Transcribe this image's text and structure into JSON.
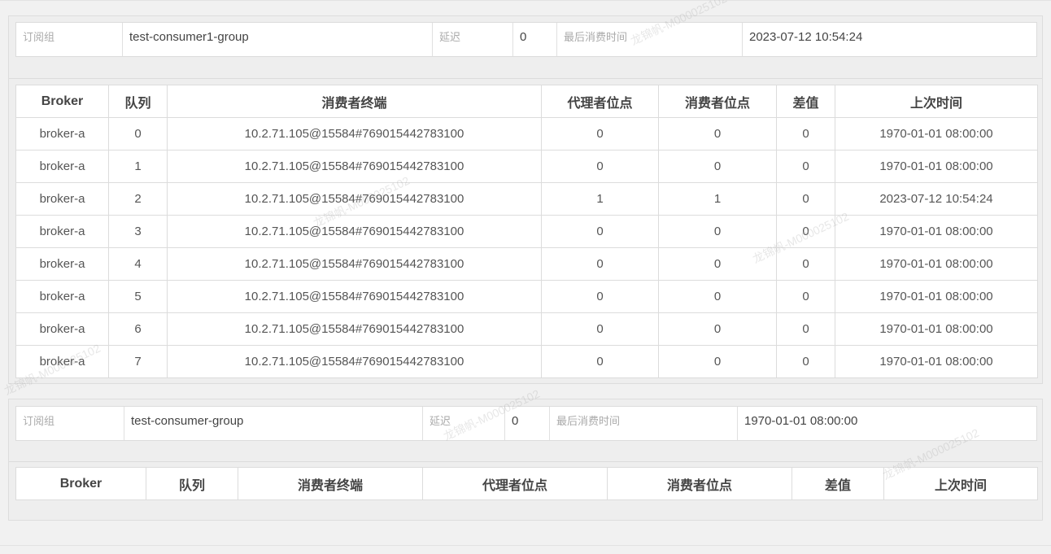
{
  "watermark": "龙锦帆-M000025102",
  "groups": [
    {
      "info": {
        "group_label": "订阅组",
        "group_value": "test-consumer1-group",
        "delay_label": "延迟",
        "delay_value": "0",
        "last_label": "最后消费时间",
        "last_value": "2023-07-12 10:54:24"
      },
      "headers": [
        "Broker",
        "队列",
        "消费者终端",
        "代理者位点",
        "消费者位点",
        "差值",
        "上次时间"
      ],
      "rows": [
        [
          "broker-a",
          "0",
          "10.2.71.105@15584#769015442783100",
          "0",
          "0",
          "0",
          "1970-01-01 08:00:00"
        ],
        [
          "broker-a",
          "1",
          "10.2.71.105@15584#769015442783100",
          "0",
          "0",
          "0",
          "1970-01-01 08:00:00"
        ],
        [
          "broker-a",
          "2",
          "10.2.71.105@15584#769015442783100",
          "1",
          "1",
          "0",
          "2023-07-12 10:54:24"
        ],
        [
          "broker-a",
          "3",
          "10.2.71.105@15584#769015442783100",
          "0",
          "0",
          "0",
          "1970-01-01 08:00:00"
        ],
        [
          "broker-a",
          "4",
          "10.2.71.105@15584#769015442783100",
          "0",
          "0",
          "0",
          "1970-01-01 08:00:00"
        ],
        [
          "broker-a",
          "5",
          "10.2.71.105@15584#769015442783100",
          "0",
          "0",
          "0",
          "1970-01-01 08:00:00"
        ],
        [
          "broker-a",
          "6",
          "10.2.71.105@15584#769015442783100",
          "0",
          "0",
          "0",
          "1970-01-01 08:00:00"
        ],
        [
          "broker-a",
          "7",
          "10.2.71.105@15584#769015442783100",
          "0",
          "0",
          "0",
          "1970-01-01 08:00:00"
        ]
      ]
    },
    {
      "info": {
        "group_label": "订阅组",
        "group_value": "test-consumer-group",
        "delay_label": "延迟",
        "delay_value": "0",
        "last_label": "最后消费时间",
        "last_value": "1970-01-01 08:00:00"
      },
      "headers": [
        "Broker",
        "队列",
        "消费者终端",
        "代理者位点",
        "消费者位点",
        "差值",
        "上次时间"
      ],
      "rows": []
    }
  ]
}
